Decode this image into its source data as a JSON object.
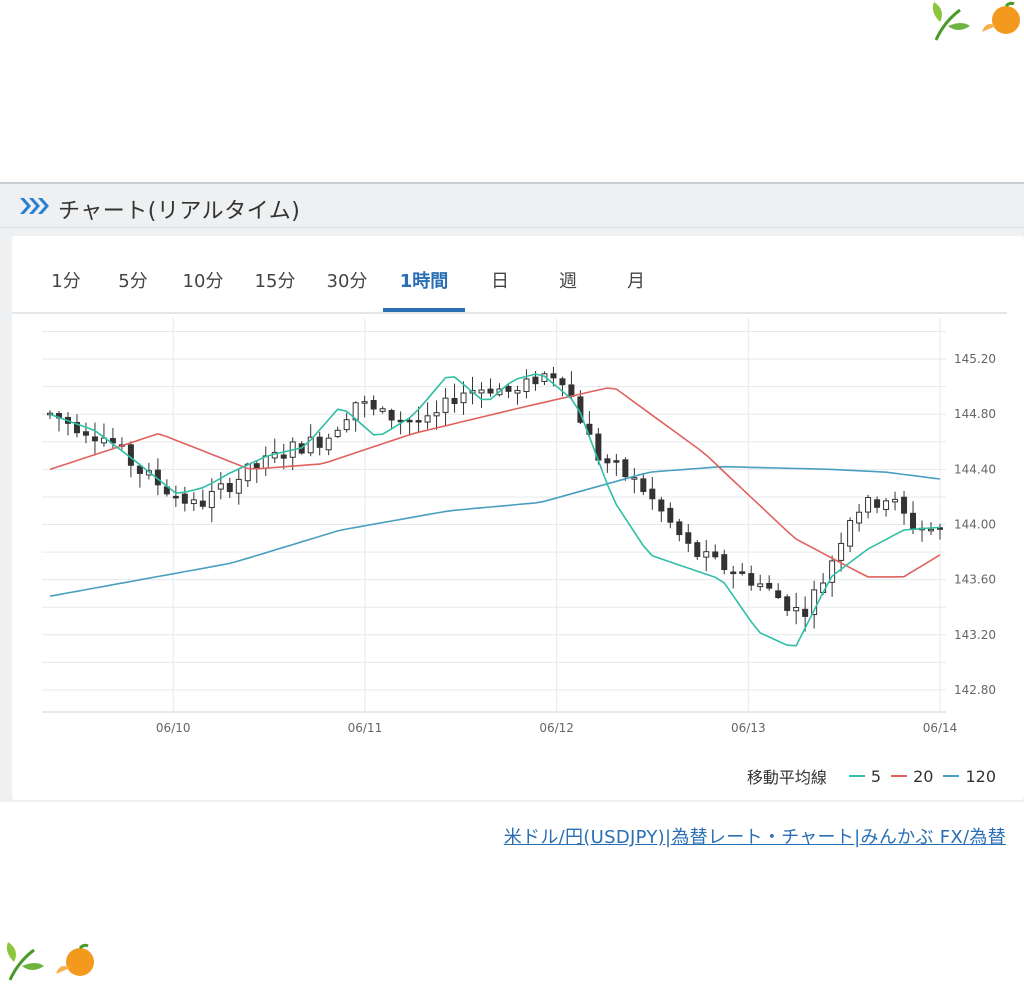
{
  "header": {
    "title": "チャート(リアルタイム)"
  },
  "tabs": [
    {
      "label": "1分",
      "active": false
    },
    {
      "label": "5分",
      "active": false
    },
    {
      "label": "10分",
      "active": false
    },
    {
      "label": "15分",
      "active": false
    },
    {
      "label": "30分",
      "active": false
    },
    {
      "label": "1時間",
      "active": true
    },
    {
      "label": "日",
      "active": false
    },
    {
      "label": "週",
      "active": false
    },
    {
      "label": "月",
      "active": false
    }
  ],
  "legend": {
    "title": "移動平均線",
    "items": [
      {
        "label": "5",
        "color": "#2fbfa5"
      },
      {
        "label": "20",
        "color": "#e0625e"
      },
      {
        "label": "120",
        "color": "#4a9fc0"
      }
    ]
  },
  "source": {
    "text": "米ドル/円(USDJPY)|為替レート・チャート|みんかぶ FX/為替"
  },
  "colors": {
    "accent": "#2a6fb3",
    "up_candle": "#ffffff",
    "down_candle": "#333333"
  },
  "chart_data": {
    "type": "candlestick",
    "x_ticks": [
      "06/10",
      "06/11",
      "06/12",
      "06/13",
      "06/14"
    ],
    "y_ticks": [
      142.8,
      143.2,
      143.6,
      144.0,
      144.4,
      144.8,
      145.2
    ],
    "ylim": [
      142.64,
      145.44
    ],
    "grid": true,
    "y_axis_side": "right",
    "candle_count": 100,
    "ohlc_close_path": [
      [
        0,
        144.8
      ],
      [
        8,
        144.62
      ],
      [
        12,
        144.4
      ],
      [
        17,
        144.22
      ],
      [
        20,
        144.13
      ],
      [
        27,
        144.38
      ],
      [
        33,
        144.55
      ],
      [
        38,
        144.63
      ],
      [
        42,
        144.9
      ],
      [
        45,
        144.8
      ],
      [
        52,
        144.73
      ],
      [
        56,
        144.96
      ],
      [
        60,
        145.0
      ],
      [
        64,
        144.95
      ],
      [
        67,
        145.08
      ],
      [
        70,
        145.1
      ],
      [
        75,
        144.5
      ],
      [
        81,
        144.28
      ],
      [
        88,
        143.8
      ],
      [
        97,
        143.58
      ],
      [
        103,
        143.35
      ],
      [
        106,
        143.6
      ],
      [
        110,
        144.1
      ],
      [
        115,
        144.2
      ],
      [
        118,
        144.0
      ],
      [
        122,
        143.95
      ]
    ],
    "ma5_path": [
      [
        0,
        144.8
      ],
      [
        5,
        144.68
      ],
      [
        9,
        144.48
      ],
      [
        14,
        144.22
      ],
      [
        17,
        144.27
      ],
      [
        20,
        144.38
      ],
      [
        24,
        144.5
      ],
      [
        28,
        144.56
      ],
      [
        32,
        144.86
      ],
      [
        36,
        144.63
      ],
      [
        40,
        144.79
      ],
      [
        44,
        145.1
      ],
      [
        48,
        144.88
      ],
      [
        51,
        145.05
      ],
      [
        54,
        145.1
      ],
      [
        58,
        144.88
      ],
      [
        62,
        144.18
      ],
      [
        66,
        143.78
      ],
      [
        70,
        143.69
      ],
      [
        74,
        143.6
      ],
      [
        78,
        143.22
      ],
      [
        82,
        143.1
      ],
      [
        86,
        143.62
      ],
      [
        90,
        143.82
      ],
      [
        94,
        143.96
      ],
      [
        98,
        143.98
      ]
    ],
    "ma20_path": [
      [
        0,
        144.4
      ],
      [
        12,
        144.66
      ],
      [
        22,
        144.4
      ],
      [
        30,
        144.44
      ],
      [
        40,
        144.66
      ],
      [
        52,
        144.85
      ],
      [
        62,
        145.0
      ],
      [
        72,
        144.52
      ],
      [
        82,
        143.9
      ],
      [
        90,
        143.62
      ],
      [
        94,
        143.62
      ],
      [
        98,
        143.78
      ]
    ],
    "ma120_path": [
      [
        0,
        143.48
      ],
      [
        20,
        143.72
      ],
      [
        32,
        143.96
      ],
      [
        44,
        144.1
      ],
      [
        54,
        144.16
      ],
      [
        66,
        144.38
      ],
      [
        74,
        144.42
      ],
      [
        86,
        144.4
      ],
      [
        92,
        144.38
      ],
      [
        98,
        144.33
      ]
    ]
  }
}
